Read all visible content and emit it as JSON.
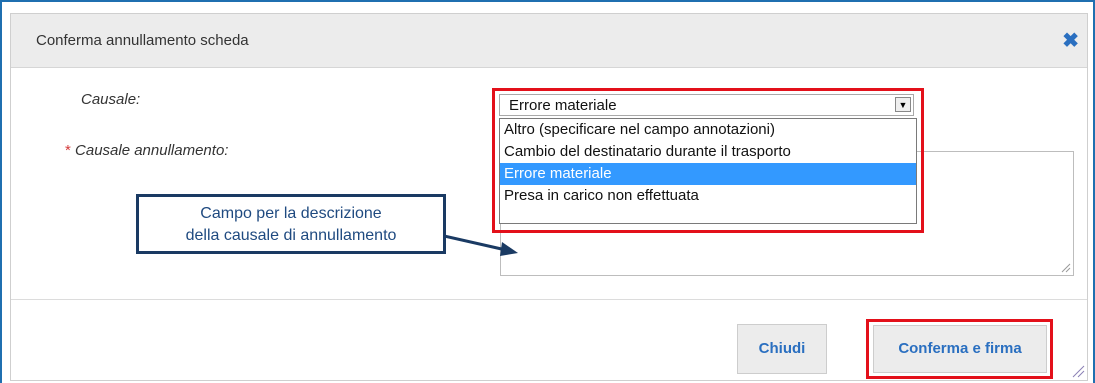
{
  "dialog": {
    "title": "Conferma annullamento scheda",
    "close_icon": "close-icon"
  },
  "form": {
    "causale_label": "Causale:",
    "causale_selected": "Errore materiale",
    "causale_options": [
      "Altro (specificare nel campo annotazioni)",
      "Cambio del destinatario durante il trasporto",
      "Errore materiale",
      "Presa in carico non effettuata"
    ],
    "required_mark": "*",
    "annullamento_label": "Causale annullamento:",
    "annullamento_value": ""
  },
  "annotation": {
    "line1": "Campo per la descrizione",
    "line2": "della causale di annullamento"
  },
  "footer": {
    "close_label": "Chiudi",
    "confirm_label": "Conferma e firma"
  },
  "colors": {
    "accent": "#2a6fc0",
    "highlight": "#e3101a",
    "selection": "#3399ff",
    "callout_border": "#1a3a63"
  }
}
